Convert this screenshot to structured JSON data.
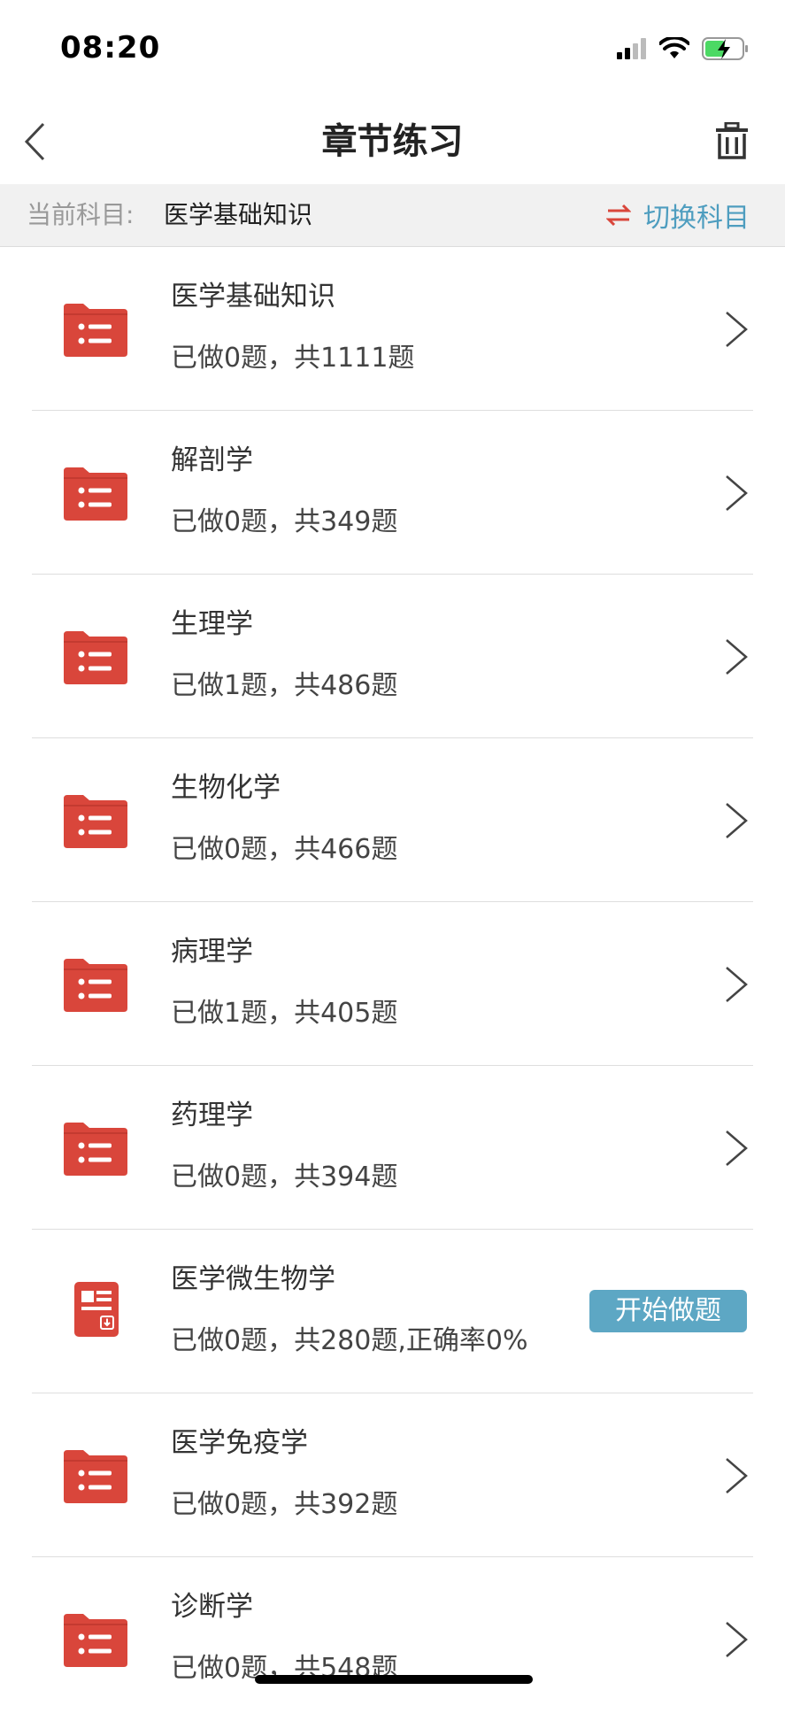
{
  "status_bar": {
    "time": "08:20"
  },
  "nav": {
    "title": "章节练习"
  },
  "subject_bar": {
    "label": "当前科目:",
    "value": "医学基础知识",
    "switch_label": "切换科目"
  },
  "chapters": [
    {
      "title": "医学基础知识",
      "progress": "已做0题，共1111题",
      "action": "chevron"
    },
    {
      "title": "解剖学",
      "progress": "已做0题，共349题",
      "action": "chevron"
    },
    {
      "title": "生理学",
      "progress": "已做1题，共486题",
      "action": "chevron"
    },
    {
      "title": "生物化学",
      "progress": "已做0题，共466题",
      "action": "chevron"
    },
    {
      "title": "病理学",
      "progress": "已做1题，共405题",
      "action": "chevron"
    },
    {
      "title": "药理学",
      "progress": "已做0题，共394题",
      "action": "chevron"
    },
    {
      "title": "医学微生物学",
      "progress": "已做0题，共280题,正确率0%",
      "action": "start",
      "action_label": "开始做题"
    },
    {
      "title": "医学免疫学",
      "progress": "已做0题，共392题",
      "action": "chevron"
    },
    {
      "title": "诊断学",
      "progress": "已做0题，共548题",
      "action": "chevron"
    }
  ],
  "colors": {
    "accent_red": "#d9463b",
    "accent_blue": "#5da7c4",
    "battery_green": "#4cd964"
  }
}
